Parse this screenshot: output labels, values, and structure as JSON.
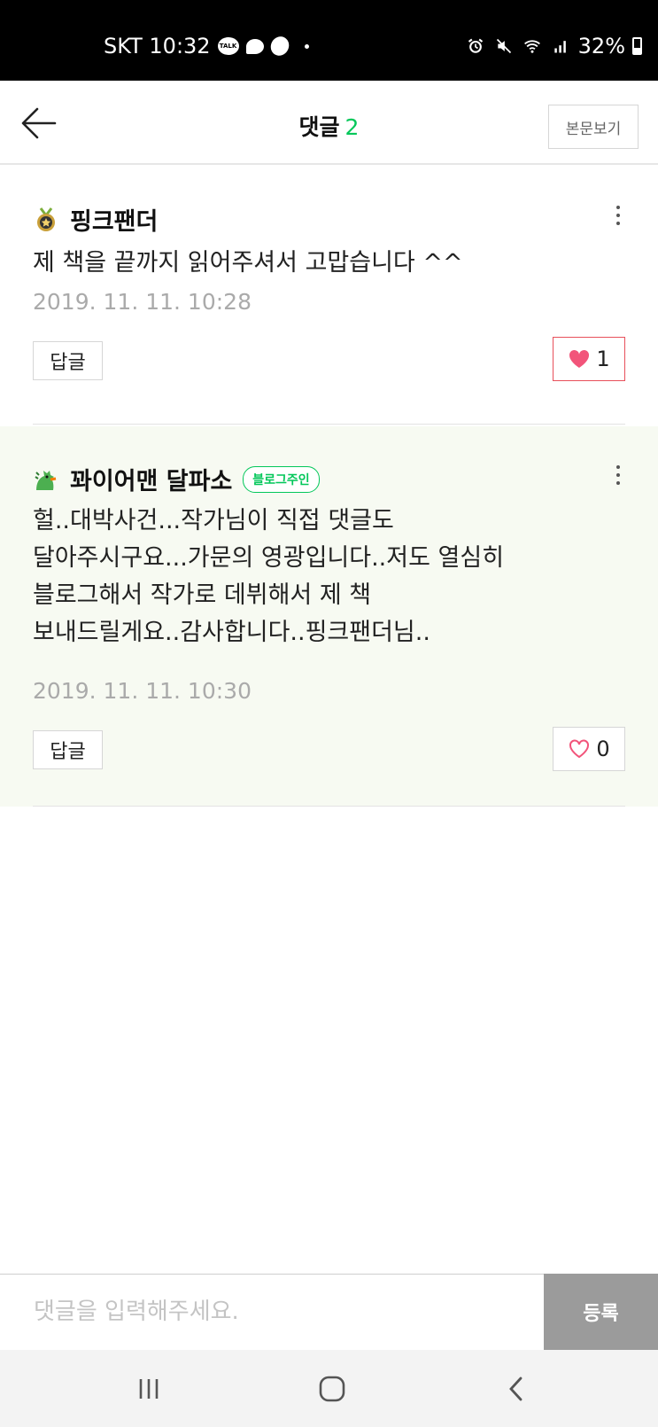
{
  "status_bar": {
    "carrier_time": "SKT 10:32",
    "talk_label": "TALK",
    "battery": "32%"
  },
  "header": {
    "title": "댓글",
    "count": "2",
    "view_post_label": "본문보기"
  },
  "comments": [
    {
      "author": "핑크팬더",
      "text": "제 책을 끝까지 읽어주셔서 고맙습니다 ^^",
      "date": "2019. 11. 11. 10:28",
      "reply_label": "답글",
      "likes": "1",
      "liked": true
    },
    {
      "author": "꽈이어맨 달파소",
      "badge": "블로그주인",
      "text": "헐..대박사건...작가님이 직접 댓글도\n달아주시구요...가문의 영광입니다..저도 열심히\n블로그해서 작가로 데뷔해서 제 책\n보내드릴게요..감사합니다..핑크팬더님..",
      "date": "2019. 11. 11. 10:30",
      "reply_label": "답글",
      "likes": "0",
      "liked": false
    }
  ],
  "input": {
    "placeholder": "댓글을 입력해주세요.",
    "submit_label": "등록"
  },
  "colors": {
    "accent_green": "#03c75a",
    "like_red": "#e8505b",
    "owner_bg": "#f7faf2"
  }
}
